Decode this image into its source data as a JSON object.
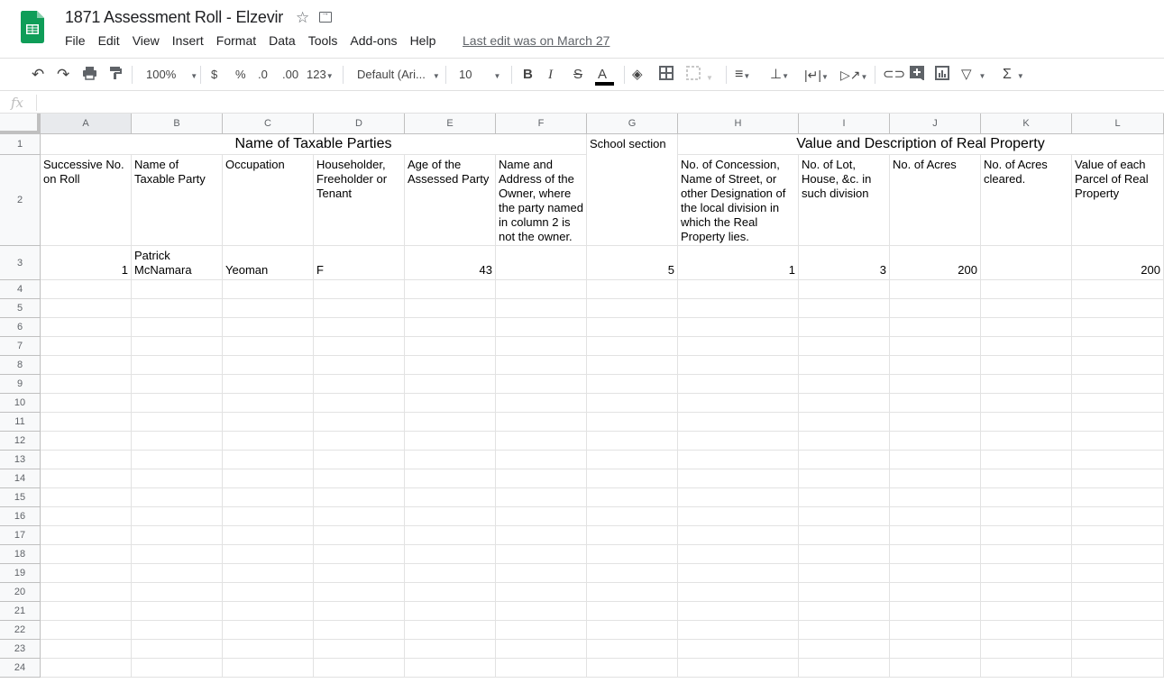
{
  "app": {
    "title": "1871 Assessment Roll - Elzevir",
    "last_edit": "Last edit was on March 27",
    "brand_color": "#0f9d58"
  },
  "menu": [
    "File",
    "Edit",
    "View",
    "Insert",
    "Format",
    "Data",
    "Tools",
    "Add-ons",
    "Help"
  ],
  "toolbar": {
    "zoom": "100%",
    "currency": "$",
    "percent": "%",
    "dec_decrease": ".0",
    "dec_increase": ".00",
    "more_formats": "123",
    "font": "Default (Ari...",
    "font_size": "10",
    "bold": "B",
    "italic": "I",
    "strikethrough": "S",
    "text_color": "A",
    "sum": "Σ"
  },
  "formula_bar": {
    "label": "fx",
    "value": ""
  },
  "columns": [
    "A",
    "B",
    "C",
    "D",
    "E",
    "F",
    "G",
    "H",
    "I",
    "J",
    "K",
    "L"
  ],
  "rows": [
    "1",
    "2",
    "3",
    "4",
    "5",
    "6",
    "7",
    "8",
    "9",
    "10",
    "11",
    "12",
    "13",
    "14",
    "15",
    "16",
    "17",
    "18",
    "19",
    "20",
    "21",
    "22",
    "23",
    "24"
  ],
  "sheet": {
    "row1": {
      "taxable_parties": "Name of Taxable Parties",
      "school_section": "School section",
      "real_property": "Value and Description of Real Property"
    },
    "row2": {
      "A": "Successive No. on Roll",
      "B": "Name of Taxable Party",
      "C": "Occupation",
      "D": "Householder, Freeholder or Tenant",
      "E": "Age of the Assessed Party",
      "F": "Name and Address of the Owner, where the party named in column 2 is not the owner.",
      "H": "No. of Concession, Name of Street, or other Designation of the local division in which the Real Property lies.",
      "I": "No. of Lot, House, &c. in such division",
      "J": "No. of Acres",
      "K": "No. of Acres cleared.",
      "L": "Value of each Parcel of Real Property"
    },
    "row3": {
      "A": "1",
      "B": "Patrick McNamara",
      "C": "Yeoman",
      "D": "F",
      "E": "43",
      "F": "",
      "G": "5",
      "H": "1",
      "I": "3",
      "J": "200",
      "K": "",
      "L": "200"
    }
  }
}
